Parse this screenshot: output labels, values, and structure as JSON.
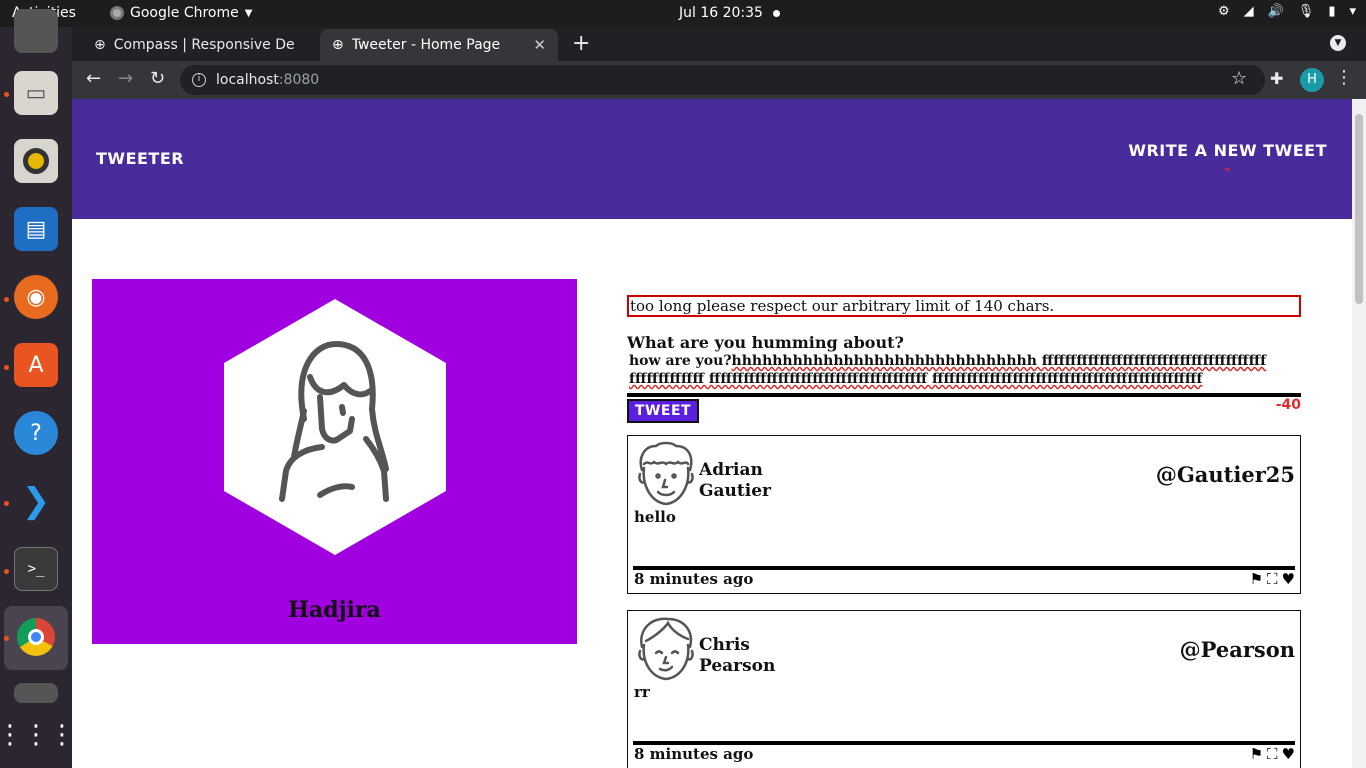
{
  "system": {
    "activities": "Activities",
    "app_name": "Google Chrome",
    "clock": "Jul 16  20:35"
  },
  "browser": {
    "tabs": [
      {
        "label": "Compass | Responsive De",
        "active": false
      },
      {
        "label": "Tweeter - Home Page",
        "active": true
      }
    ],
    "url_host": "localhost",
    "url_port": ":8080",
    "profile_initial": "H"
  },
  "header": {
    "brand": "Tweeter",
    "write_new": "Write a new tweet"
  },
  "profile": {
    "name": "Hadjira",
    "card_color": "#a000e0"
  },
  "compose": {
    "error": "too long please respect our arbitrary limit of 140 chars.",
    "label": "What are you humming about?",
    "text_plain": "how are you?",
    "text_typo": "hhhhhhhhhhhhhhhhhhhhhhhhhhhhhh ffffffffffffffffffffffffffffffffffffffffffffffffffff ffffffffffffffffffffffffffffffffffffff fffffffffffffffffffffffffffffffffffffffffffffff",
    "button": "Tweet",
    "counter": "-40"
  },
  "tweets": [
    {
      "name": "Adrian Gautier",
      "handle": "@Gautier25",
      "body": "hello",
      "time": "8 minutes ago"
    },
    {
      "name": "Chris Pearson",
      "handle": "@Pearson",
      "body": "rr",
      "time": "8 minutes ago"
    }
  ],
  "colors": {
    "header_bg": "#4a2b9b",
    "accent_red": "#e52a2a",
    "tweet_button": "#5b1fe0"
  }
}
